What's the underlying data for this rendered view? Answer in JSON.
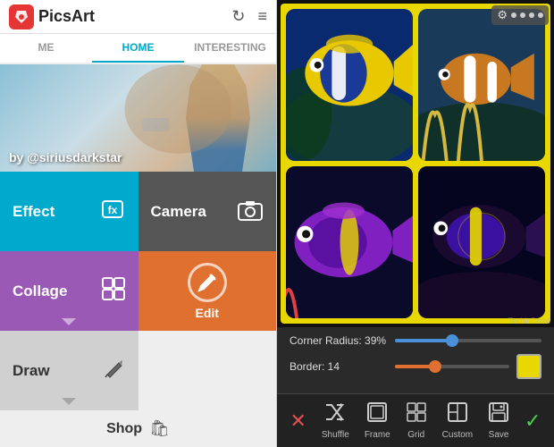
{
  "app": {
    "name": "PicsArt",
    "logo_letter": "P"
  },
  "left": {
    "tabs": [
      {
        "label": "ME",
        "active": false
      },
      {
        "label": "HOME",
        "active": true
      },
      {
        "label": "INTERESTING",
        "active": false
      }
    ],
    "hero": {
      "caption": "by @siriusdarkstar"
    },
    "menu": [
      {
        "id": "effect",
        "label": "Effect",
        "icon": "✦",
        "color_class": "cell-effect"
      },
      {
        "id": "camera",
        "label": "Camera",
        "icon": "⊙",
        "color_class": "cell-camera"
      },
      {
        "id": "collage",
        "label": "Collage",
        "icon": "⊞",
        "color_class": "cell-collage"
      },
      {
        "id": "edit",
        "label": "Edit",
        "icon": "✎",
        "color_class": "cell-edit"
      },
      {
        "id": "draw",
        "label": "Draw",
        "icon": "✏",
        "color_class": "cell-draw"
      },
      {
        "id": "shop",
        "label": "Shop",
        "icon": "🛍"
      }
    ],
    "shop_label": "Shop"
  },
  "right": {
    "corner_radius_label": "Corner Radius: 39%",
    "corner_radius_value": 39,
    "border_label": "Border: 14",
    "border_value": 14,
    "toolbar": {
      "cancel": "✕",
      "shuffle_label": "Shuffle",
      "frame_label": "Frame",
      "grid_label": "Grid",
      "custom_label": "Custom",
      "save_label": "Save",
      "confirm": "✓"
    }
  },
  "watermark": "TechinDroid"
}
